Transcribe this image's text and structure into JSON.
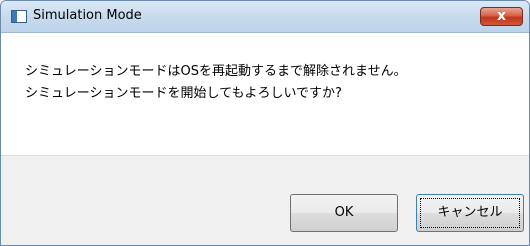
{
  "window": {
    "title": "Simulation Mode",
    "close_glyph": "x"
  },
  "message": {
    "line1": "シミュレーションモードはOSを再起動するまで解除されません。",
    "line2": "シミュレーションモードを開始してもよろしいですか?"
  },
  "buttons": {
    "ok_label": "OK",
    "cancel_label": "キャンセル"
  },
  "icons": {
    "app": "window-app-icon",
    "close": "close-icon"
  },
  "colors": {
    "titlebar": "#c9dcee",
    "close_button": "#c1371b",
    "footer": "#f0f0f0",
    "default_button_border": "#3c7fb1"
  }
}
